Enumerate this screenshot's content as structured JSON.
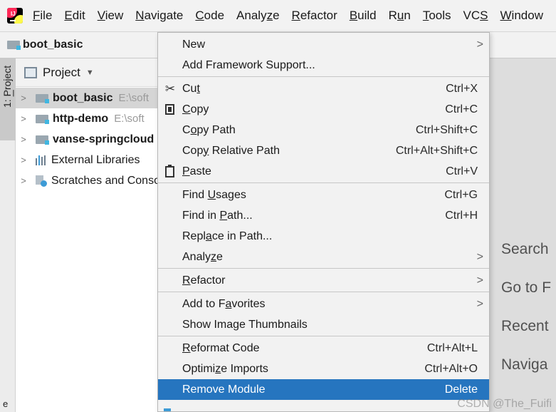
{
  "menubar": {
    "items": [
      {
        "pre": "",
        "u": "F",
        "post": "ile"
      },
      {
        "pre": "",
        "u": "E",
        "post": "dit"
      },
      {
        "pre": "",
        "u": "V",
        "post": "iew"
      },
      {
        "pre": "",
        "u": "N",
        "post": "avigate"
      },
      {
        "pre": "",
        "u": "C",
        "post": "ode"
      },
      {
        "pre": "Analy",
        "u": "z",
        "post": "e"
      },
      {
        "pre": "",
        "u": "R",
        "post": "efactor"
      },
      {
        "pre": "",
        "u": "B",
        "post": "uild"
      },
      {
        "pre": "R",
        "u": "u",
        "post": "n"
      },
      {
        "pre": "",
        "u": "T",
        "post": "ools"
      },
      {
        "pre": "VC",
        "u": "S",
        "post": ""
      },
      {
        "pre": "",
        "u": "W",
        "post": "indow"
      }
    ]
  },
  "navbar": {
    "crumb": "boot_basic"
  },
  "stripe": {
    "prefix": "1: ",
    "u": "P",
    "rest": "roject",
    "bottom": "e"
  },
  "project_panel": {
    "title": "Project",
    "dropdown": "▼",
    "tree": [
      {
        "name": "boot_basic",
        "path": "E:\\soft",
        "bold": true
      },
      {
        "name": "http-demo",
        "path": "E:\\soft",
        "bold": true
      },
      {
        "name": "vanse-springcloud",
        "path": "",
        "bold": true
      },
      {
        "name": "External Libraries",
        "path": "",
        "bold": false
      },
      {
        "name": "Scratches and Consoles",
        "path": "",
        "bold": false
      }
    ]
  },
  "editor_hints": {
    "search": "Search",
    "goto": "Go to F",
    "recent": "Recent",
    "navigate": "Naviga"
  },
  "context_menu": {
    "new": {
      "label": "New"
    },
    "add_framework": {
      "label": "Add Framework Support..."
    },
    "cut": {
      "pre": "Cu",
      "u": "t",
      "post": "",
      "shortcut": "Ctrl+X"
    },
    "copy": {
      "pre": "",
      "u": "C",
      "post": "opy",
      "shortcut": "Ctrl+C"
    },
    "copy_path": {
      "pre": "C",
      "u": "o",
      "post": "py Path",
      "shortcut": "Ctrl+Shift+C"
    },
    "copy_relative": {
      "pre": "Cop",
      "u": "y",
      "post": " Relative Path",
      "shortcut": "Ctrl+Alt+Shift+C"
    },
    "paste": {
      "pre": "",
      "u": "P",
      "post": "aste",
      "shortcut": "Ctrl+V"
    },
    "find_usages": {
      "pre": "Find ",
      "u": "U",
      "post": "sages",
      "shortcut": "Ctrl+G"
    },
    "find_in_path": {
      "pre": "Find in ",
      "u": "P",
      "post": "ath...",
      "shortcut": "Ctrl+H"
    },
    "replace_in_path": {
      "pre": "Repl",
      "u": "a",
      "post": "ce in Path..."
    },
    "analyze": {
      "pre": "Analy",
      "u": "z",
      "post": "e"
    },
    "refactor": {
      "pre": "",
      "u": "R",
      "post": "efactor"
    },
    "add_favorites": {
      "pre": "Add to F",
      "u": "a",
      "post": "vorites"
    },
    "show_thumbnails": {
      "label": "Show Image Thumbnails"
    },
    "reformat": {
      "pre": "",
      "u": "R",
      "post": "eformat Code",
      "shortcut": "Ctrl+Alt+L"
    },
    "optimize": {
      "pre": "Optimi",
      "u": "z",
      "post": "e Imports",
      "shortcut": "Ctrl+Alt+O"
    },
    "remove_module": {
      "label": "Remove Module",
      "shortcut": "Delete"
    },
    "submenu_glyph": ">"
  },
  "watermark": "CSDN @The_Fuifi",
  "icons": {
    "cut": "scissors-icon",
    "copy": "copy-icon",
    "paste": "paste-icon",
    "submenu": "chevron-right-icon"
  }
}
